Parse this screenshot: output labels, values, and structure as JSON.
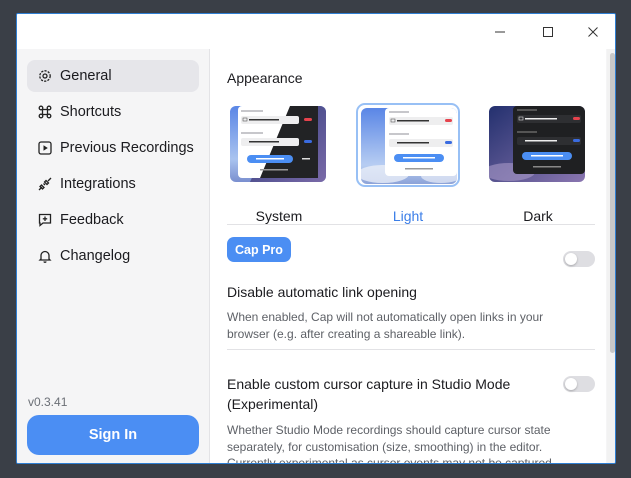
{
  "window": {
    "minimize_glyph": "—",
    "maximize_glyph": "☐",
    "close_glyph": "✕"
  },
  "sidebar": {
    "items": [
      {
        "label": "General",
        "icon": "gear-icon"
      },
      {
        "label": "Shortcuts",
        "icon": "command-icon"
      },
      {
        "label": "Previous Recordings",
        "icon": "play-square-icon"
      },
      {
        "label": "Integrations",
        "icon": "plug-icon"
      },
      {
        "label": "Feedback",
        "icon": "message-plus-icon"
      },
      {
        "label": "Changelog",
        "icon": "bell-icon"
      }
    ],
    "active_index": 0,
    "version": "v0.3.41",
    "sign_in_label": "Sign In"
  },
  "main": {
    "appearance_title": "Appearance",
    "themes": [
      {
        "label": "System",
        "selected": false
      },
      {
        "label": "Light",
        "selected": true
      },
      {
        "label": "Dark",
        "selected": false
      }
    ],
    "pro_badge": "Cap Pro",
    "settings": [
      {
        "title": "Disable automatic link opening",
        "description": "When enabled, Cap will not automatically open links in your browser (e.g. after creating a shareable link).",
        "enabled": false
      },
      {
        "title": "Enable custom cursor capture in Studio Mode (Experimental)",
        "description": "Whether Studio Mode recordings should capture cursor state separately, for customisation (size, smoothing) in the editor. Currently experimental as cursor events may not be captured accurately.",
        "enabled": false
      }
    ]
  },
  "colors": {
    "accent": "#4b8ef3",
    "selected_text": "#3b7ee8",
    "window_border": "#2f7fd3"
  }
}
